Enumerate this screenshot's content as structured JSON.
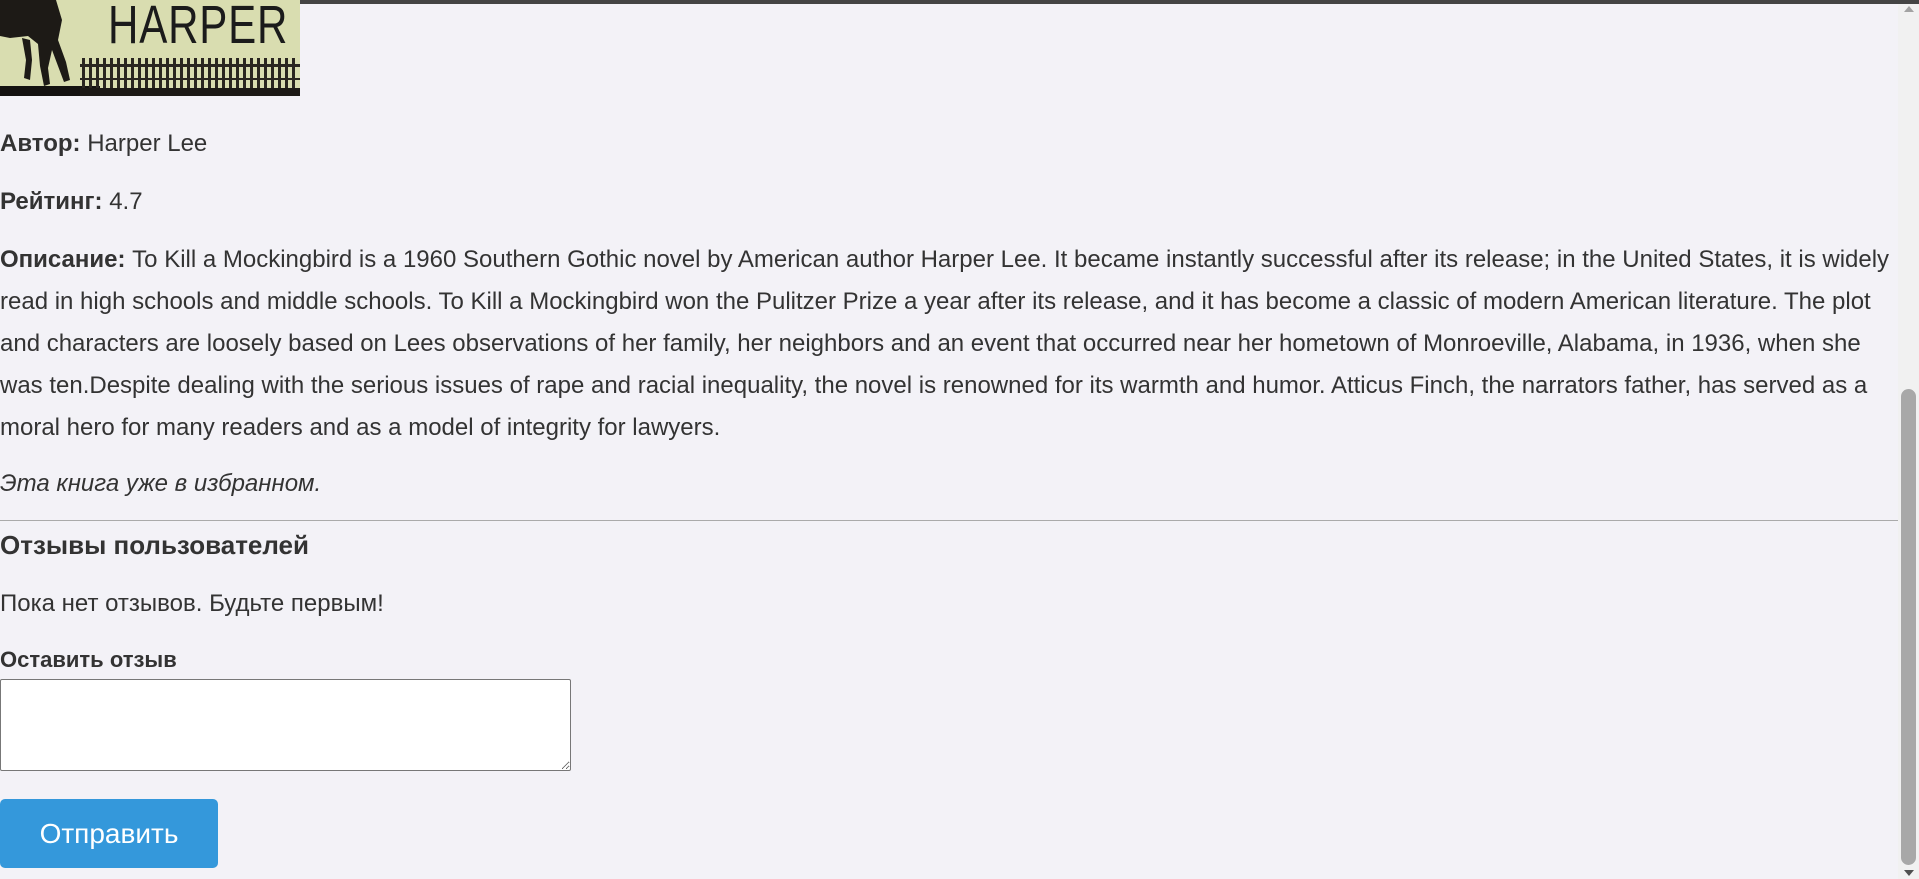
{
  "book": {
    "cover_title": "HARPER LEE",
    "author_label": "Автор:",
    "author": "Harper Lee",
    "rating_label": "Рейтинг:",
    "rating": "4.7",
    "description_label": "Описание:",
    "description": "To Kill a Mockingbird is a 1960 Southern Gothic novel by American author Harper Lee. It became instantly successful after its release; in the United States, it is widely read in high schools and middle schools. To Kill a Mockingbird won the Pulitzer Prize a year after its release, and it has become a classic of modern American literature. The plot and characters are loosely based on Lees observations of her family, her neighbors and an event that occurred near her hometown of Monroeville, Alabama, in 1936, when she was ten.Despite dealing with the serious issues of rape and racial inequality, the novel is renowned for its warmth and humor. Atticus Finch, the narrators father, has served as a moral hero for many readers and as a model of integrity for lawyers.",
    "favorite_status": "Эта книга уже в избранном."
  },
  "reviews": {
    "title": "Отзывы пользователей",
    "empty_message": "Пока нет отзывов. Будьте первым!",
    "form_label": "Оставить отзыв",
    "textarea_value": "",
    "submit_label": "Отправить"
  },
  "colors": {
    "background": "#f3f2f7",
    "text": "#333333",
    "button": "#3498db",
    "button_text": "#ffffff"
  }
}
